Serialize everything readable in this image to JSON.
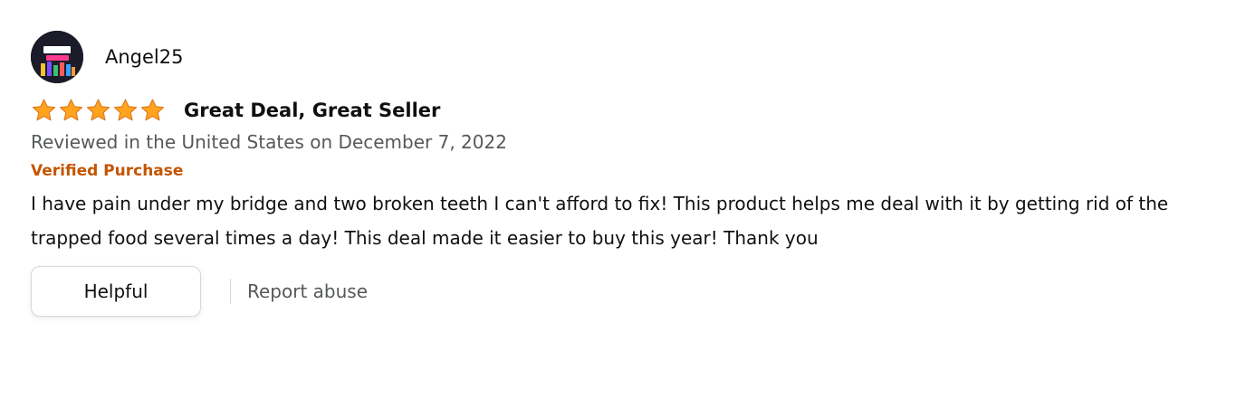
{
  "review": {
    "reviewer": {
      "name": "Angel25",
      "avatar_icon": "avatar-icon"
    },
    "rating": 5,
    "rating_max": 5,
    "title": "Great Deal, Great Seller",
    "date_text": "Reviewed in the United States on December 7, 2022",
    "verified_label": "Verified Purchase",
    "body": "I have pain under my bridge and two broken teeth I can't afford to fix! This product helps me deal with it by getting rid of the trapped food several times a day! This deal made it easier to buy this year! Thank you",
    "actions": {
      "helpful_label": "Helpful",
      "report_label": "Report abuse"
    }
  },
  "colors": {
    "star": "#ffa41c",
    "verified": "#c45500",
    "muted_text": "#565959",
    "primary_text": "#0f1111",
    "border": "#d5d9d9"
  }
}
